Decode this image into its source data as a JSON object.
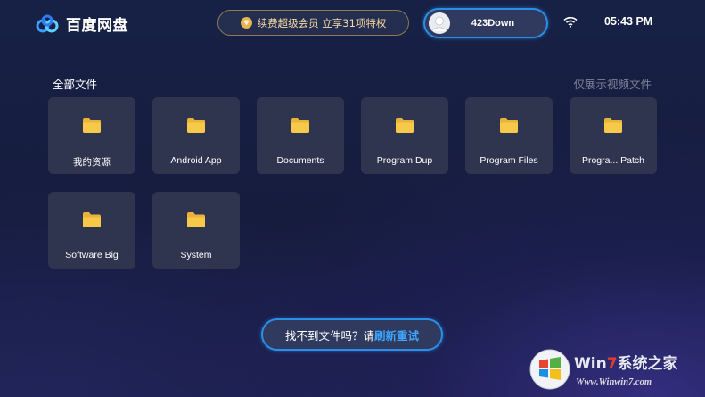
{
  "app": {
    "title": "百度网盘"
  },
  "header": {
    "vip_banner": "续费超级会员 立享31项特权",
    "username": "423Down",
    "time": "05:43 PM"
  },
  "files_section": {
    "title": "全部文件",
    "filter_label": "仅展示视频文件"
  },
  "folders": [
    {
      "name": "我的资源"
    },
    {
      "name": "Android App"
    },
    {
      "name": "Documents"
    },
    {
      "name": "Program Dup"
    },
    {
      "name": "Program Files"
    },
    {
      "name": "Progra... Patch"
    },
    {
      "name": "Software Big"
    },
    {
      "name": "System"
    }
  ],
  "refresh": {
    "prefix": "找不到文件吗？请",
    "action": "刷新重试"
  },
  "watermark": {
    "title_prefix": "Win",
    "title_accent": "7",
    "title_suffix": "系统之家",
    "url": "Www.Winwin7.com"
  },
  "colors": {
    "accent_blue": "#2a8fe6",
    "folder_yellow": "#f7c948",
    "vip_gold": "#f3d9a3",
    "tile_bg": "#30354f"
  },
  "icons": {
    "logo": "baidu-cloud-logo-icon",
    "vip": "diamond-icon",
    "avatar": "user-avatar-icon",
    "wifi": "wifi-icon",
    "folder": "folder-icon"
  }
}
